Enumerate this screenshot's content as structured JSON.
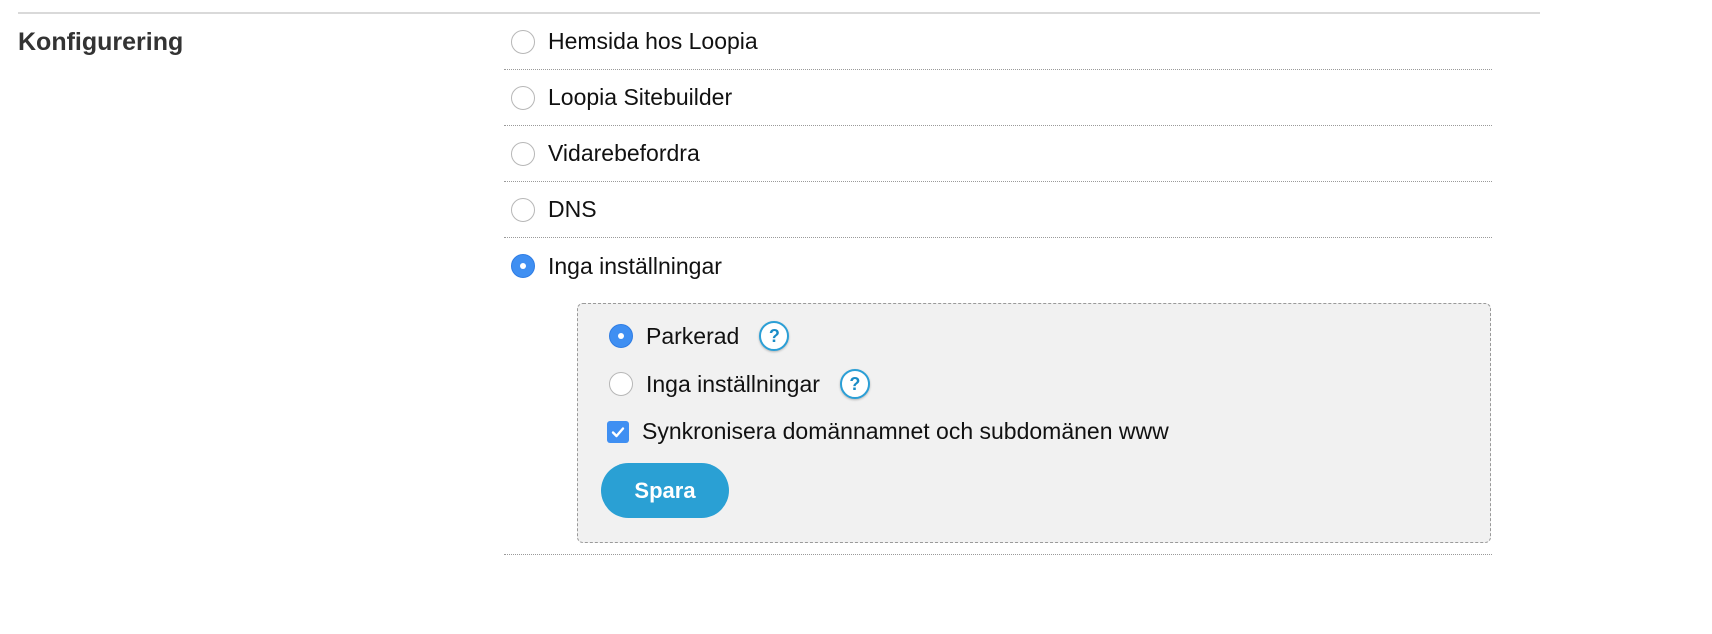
{
  "section": {
    "title": "Konfigurering"
  },
  "options": [
    {
      "label": "Hemsida hos Loopia",
      "selected": false
    },
    {
      "label": "Loopia Sitebuilder",
      "selected": false
    },
    {
      "label": "Vidarebefordra",
      "selected": false
    },
    {
      "label": "DNS",
      "selected": false
    },
    {
      "label": "Inga inställningar",
      "selected": true
    }
  ],
  "subpanel": {
    "parked_label": "Parkerad",
    "parked_selected": true,
    "none_label": "Inga inställningar",
    "none_selected": false,
    "help_glyph": "?",
    "sync_label": "Synkronisera domännamnet och subdomänen www",
    "sync_checked": true,
    "save_label": "Spara"
  },
  "colors": {
    "accent": "#3f8ff2",
    "button": "#2aa0d4",
    "panel_bg": "#f1f1f1"
  }
}
